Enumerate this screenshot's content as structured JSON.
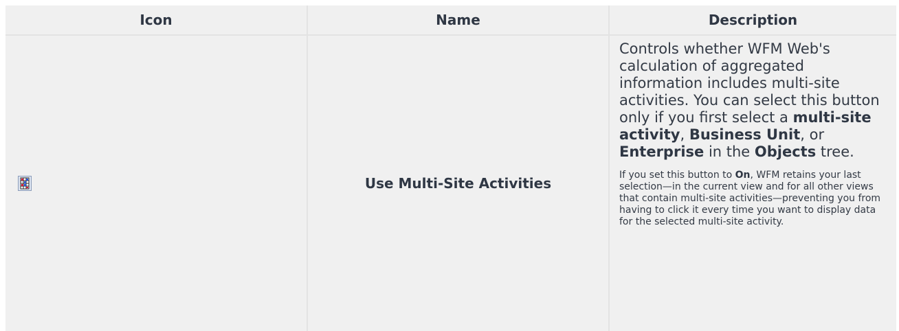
{
  "headers": {
    "icon": "Icon",
    "name": "Name",
    "description": "Description"
  },
  "row": {
    "icon_name": "multi-site-activities-icon",
    "name": "Use Multi-Site Activities",
    "desc": {
      "p1_a": "Controls whether WFM Web's calculation of aggregated information includes multi-site activities. You can select this button only if you first select a ",
      "b1": "multi-site activity",
      "p1_b": ", ",
      "b2": "Business Unit",
      "p1_c": ", or ",
      "b3": "Enterprise",
      "p1_d": " in the ",
      "b4": "Objects",
      "p1_e": " tree.",
      "p2_a": "If you set this button to ",
      "b5": "On",
      "p2_b": ",  WFM retains your last selection—in the current view and for all other views that contain multi-site activities—preventing you from having to click it every time you want to display data for the selected multi-site activity."
    }
  },
  "colors": {
    "background": "#f0f0f0",
    "text": "#333a45",
    "divider": "#e3e3e3"
  }
}
